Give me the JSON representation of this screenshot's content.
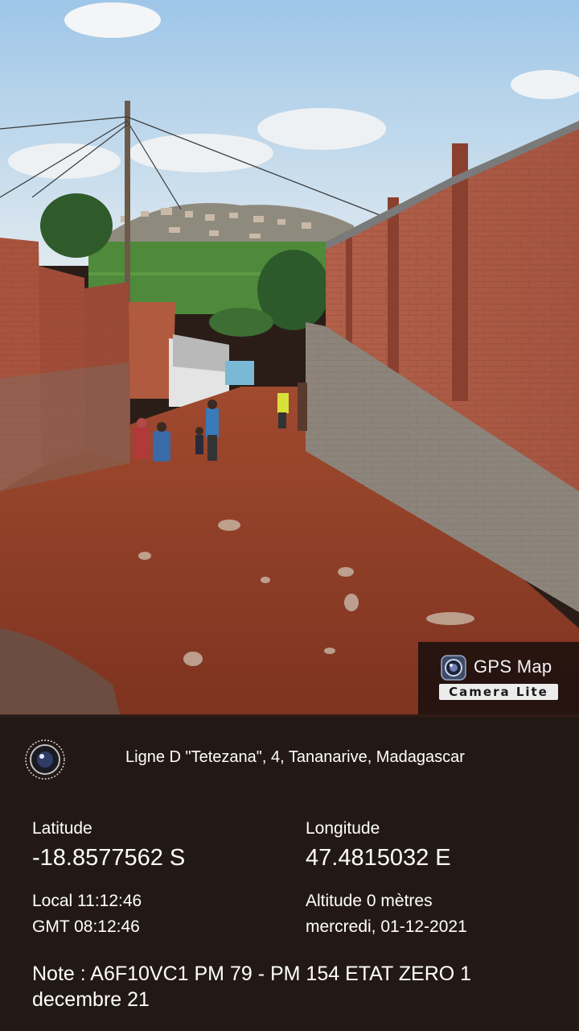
{
  "badge": {
    "title": "GPS Map",
    "subtitle": "Camera Lite"
  },
  "panel": {
    "address": "Ligne D \"Tetezana\", 4, Tananarive, Madagascar",
    "latitude_label": "Latitude",
    "latitude_value": "-18.8577562 S",
    "longitude_label": "Longitude",
    "longitude_value": "47.4815032 E",
    "local_time": "Local 11:12:46",
    "gmt_time": "GMT 08:12:46",
    "altitude": "Altitude 0 mètres",
    "date": "mercredi, 01-12-2021",
    "note": "Note : A6F10VC1  PM 79 - PM 154 ETAT ZERO  1 decembre  21"
  },
  "colors": {
    "panel_bg": "#221814",
    "text": "#ffffff",
    "sky": "#b9d6ee",
    "brick": "#a0503c",
    "soil": "#9a3f27"
  },
  "icons": {
    "badge": "camera-lens-icon",
    "panel": "camera-lens-icon"
  }
}
